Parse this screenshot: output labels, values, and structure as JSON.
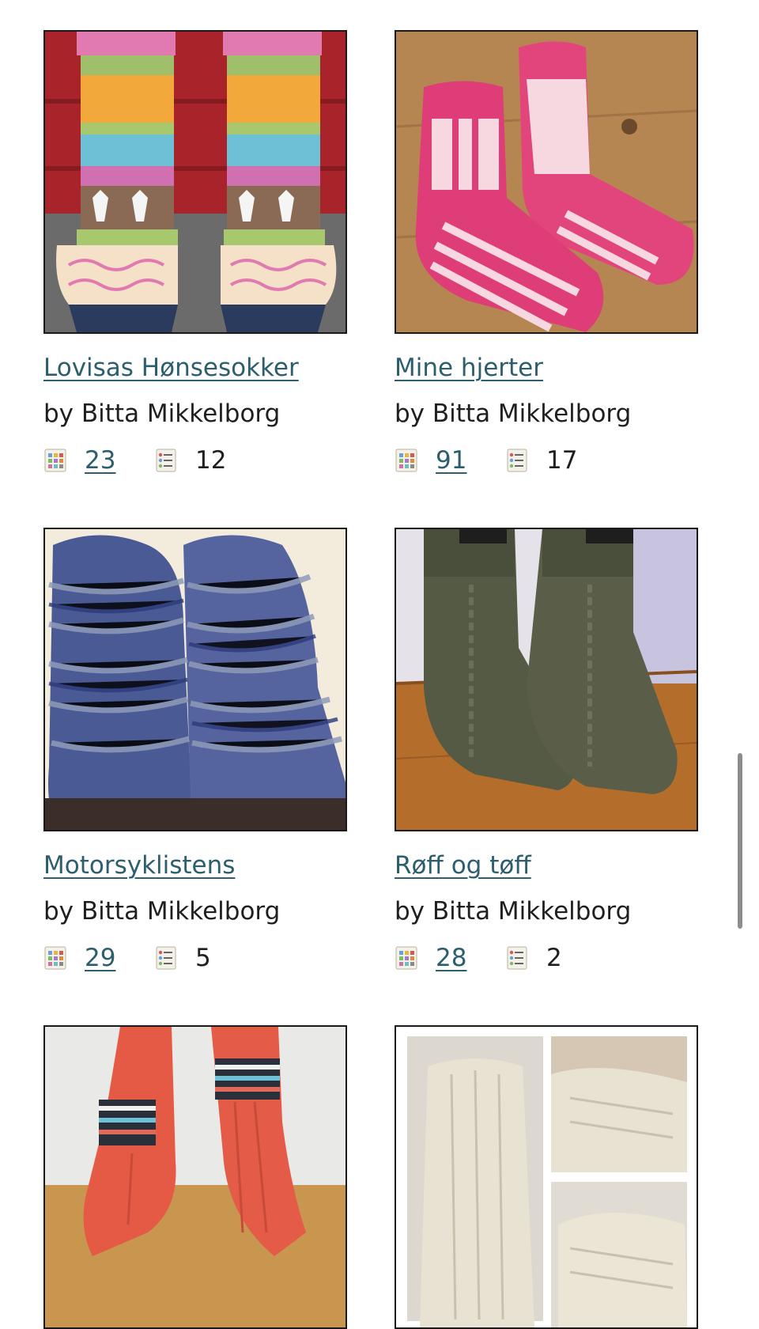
{
  "patterns": [
    {
      "title": "Lovisas Hønsesokker",
      "byline": "by Bitta Mikkelborg",
      "projects_count": "23",
      "queue_count": "12",
      "photo_description": "colorwork-socks-red-wall"
    },
    {
      "title": "Mine hjerter",
      "byline": "by Bitta Mikkelborg",
      "projects_count": "91",
      "queue_count": "17",
      "photo_description": "pink-heart-socks-wood"
    },
    {
      "title": "Motorsyklistens",
      "byline": "by Bitta Mikkelborg",
      "projects_count": "29",
      "queue_count": "5",
      "photo_description": "blue-striped-socks"
    },
    {
      "title": "Røff og tøff",
      "byline": "by Bitta Mikkelborg",
      "projects_count": "28",
      "queue_count": "2",
      "photo_description": "olive-cable-socks"
    },
    {
      "title": "",
      "byline": "",
      "projects_count": "",
      "queue_count": "",
      "photo_description": "coral-cable-socks"
    },
    {
      "title": "",
      "byline": "",
      "projects_count": "",
      "queue_count": "",
      "photo_description": "cream-lace-socks-collage"
    }
  ],
  "icons": {
    "projects": "projects-grid-icon",
    "queue": "queue-list-icon"
  },
  "colors": {
    "link": "#2c5e6e",
    "text": "#1f1f1f",
    "border": "#1a1a1a"
  }
}
